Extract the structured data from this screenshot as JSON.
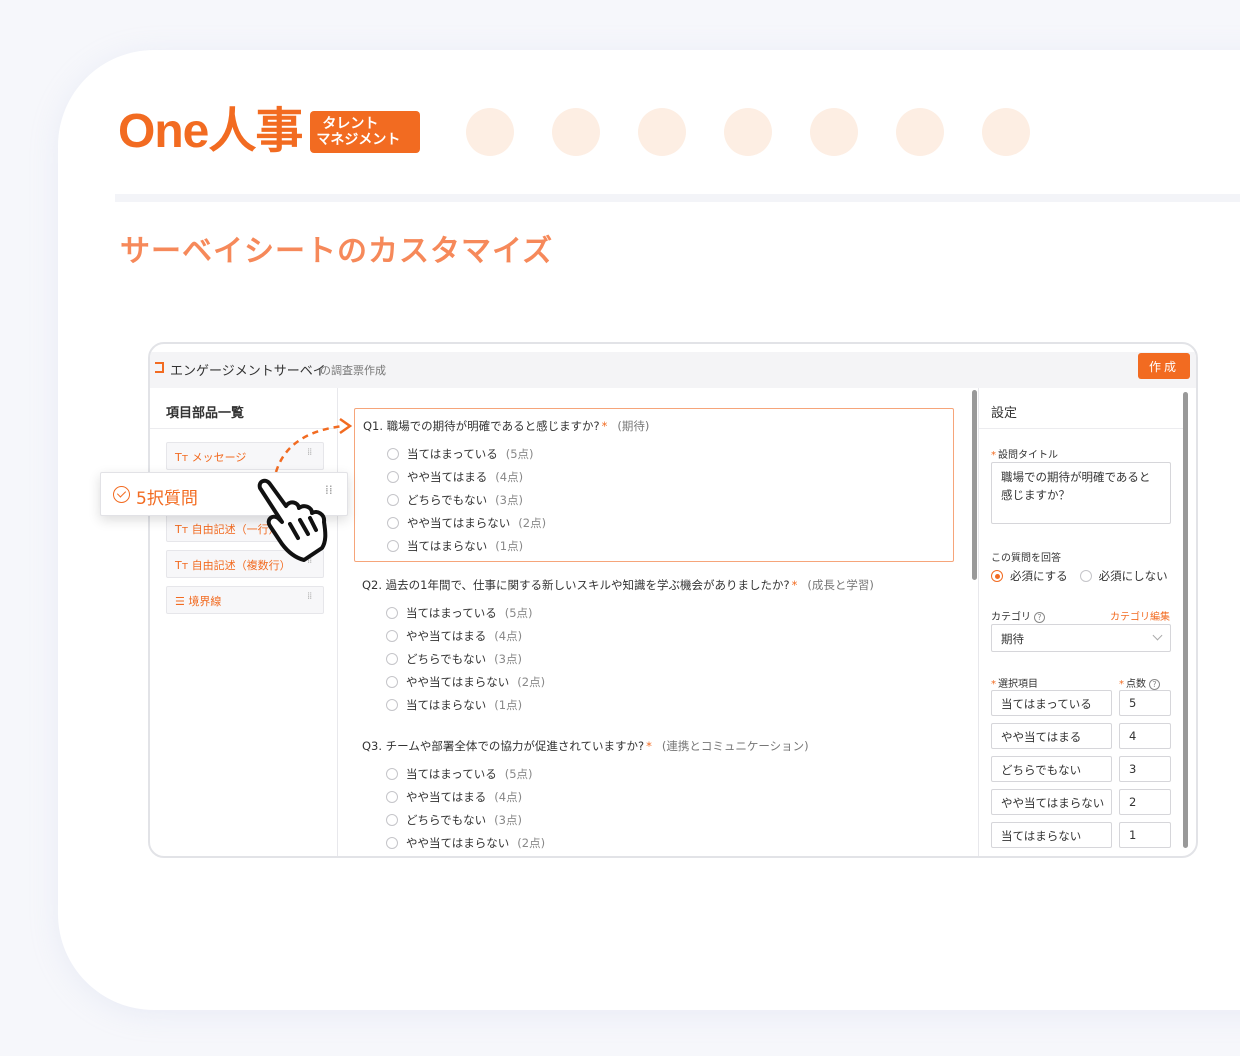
{
  "logo": {
    "text": "One人事",
    "badge_line1": "タレント",
    "badge_line2": "マネジメント"
  },
  "section_title": "サーベイシートのカスタマイズ",
  "app": {
    "title": "エンゲージメントサーベイ",
    "subtitle": "の調査票作成",
    "create_label": "作成"
  },
  "parts_panel": {
    "title": "項目部品一覧",
    "items": [
      {
        "prefix": "Tт",
        "label": "メッセージ"
      },
      {
        "prefix": "Tт",
        "label": "自由記述（一行）"
      },
      {
        "prefix": "Tт",
        "label": "自由記述（複数行）"
      },
      {
        "prefix": "☰",
        "label": "境界線"
      }
    ],
    "dragging_label": "5択質問"
  },
  "questions": [
    {
      "title": "Q1. 職場での期待が明確であると感じますか?",
      "category": "(期待)",
      "options": [
        {
          "label": "当てはまっている",
          "points": "(5点)"
        },
        {
          "label": "やや当てはまる",
          "points": "(4点)"
        },
        {
          "label": "どちらでもない",
          "points": "(3点)"
        },
        {
          "label": "やや当てはまらない",
          "points": "(2点)"
        },
        {
          "label": "当てはまらない",
          "points": "(1点)"
        }
      ]
    },
    {
      "title": "Q2. 過去の1年間で、仕事に関する新しいスキルや知識を学ぶ機会がありましたか?",
      "category": "(成長と学習)",
      "options": [
        {
          "label": "当てはまっている",
          "points": "(5点)"
        },
        {
          "label": "やや当てはまる",
          "points": "(4点)"
        },
        {
          "label": "どちらでもない",
          "points": "(3点)"
        },
        {
          "label": "やや当てはまらない",
          "points": "(2点)"
        },
        {
          "label": "当てはまらない",
          "points": "(1点)"
        }
      ]
    },
    {
      "title": "Q3. チームや部署全体での協力が促進されていますか?",
      "category": "(連携とコミュニケーション)",
      "options": [
        {
          "label": "当てはまっている",
          "points": "(5点)"
        },
        {
          "label": "やや当てはまる",
          "points": "(4点)"
        },
        {
          "label": "どちらでもない",
          "points": "(3点)"
        },
        {
          "label": "やや当てはまらない",
          "points": "(2点)"
        }
      ]
    }
  ],
  "settings": {
    "title": "設定",
    "question_title_label": "設問タイトル",
    "question_title_value": "職場での期待が明確であると感じますか？",
    "answer_label": "この質問を回答",
    "required_label": "必須にする",
    "not_required_label": "必須にしない",
    "category_label": "カテゴリ",
    "category_edit": "カテゴリ編集",
    "category_value": "期待",
    "choices_label": "選択項目",
    "score_label": "点数",
    "choices": [
      {
        "label": "当てはまっている",
        "score": "5"
      },
      {
        "label": "やや当てはまる",
        "score": "4"
      },
      {
        "label": "どちらでもない",
        "score": "3"
      },
      {
        "label": "やや当てはまらない",
        "score": "2"
      },
      {
        "label": "当てはまらない",
        "score": "1"
      }
    ]
  },
  "colors": {
    "accent": "#f26b21",
    "dot": "#fdeee3",
    "title": "#f6895a"
  }
}
